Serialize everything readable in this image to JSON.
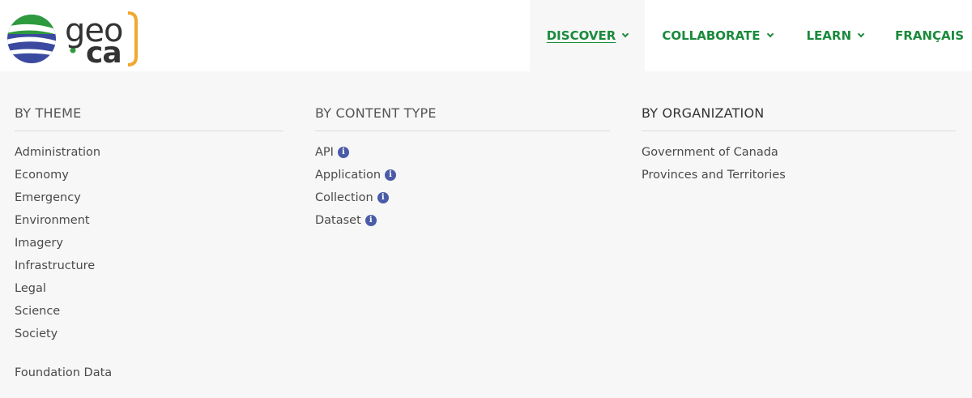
{
  "logo": {
    "text_geo": "geo",
    "text_ca": "ca",
    "icon": "globe-logo-icon"
  },
  "nav": {
    "items": [
      {
        "label": "DISCOVER",
        "active": true
      },
      {
        "label": "COLLABORATE",
        "active": false
      },
      {
        "label": "LEARN",
        "active": false
      }
    ],
    "language": "FRANÇAIS"
  },
  "menu": {
    "by_theme": {
      "title": "BY THEME",
      "items": [
        "Administration",
        "Economy",
        "Emergency",
        "Environment",
        "Imagery",
        "Infrastructure",
        "Legal",
        "Science",
        "Society"
      ],
      "extra": "Foundation Data"
    },
    "by_content_type": {
      "title": "BY CONTENT TYPE",
      "items": [
        "API",
        "Application",
        "Collection",
        "Dataset"
      ],
      "info_icon": "i"
    },
    "by_organization": {
      "title": "BY ORGANIZATION",
      "items": [
        "Government of Canada",
        "Provinces and Territories"
      ]
    }
  },
  "colors": {
    "nav_green": "#1a8a3c",
    "info_blue": "#4a5ba8",
    "logo_orange": "#f0a830",
    "logo_green": "#2e9a3e",
    "logo_blue": "#3b4aa0"
  }
}
